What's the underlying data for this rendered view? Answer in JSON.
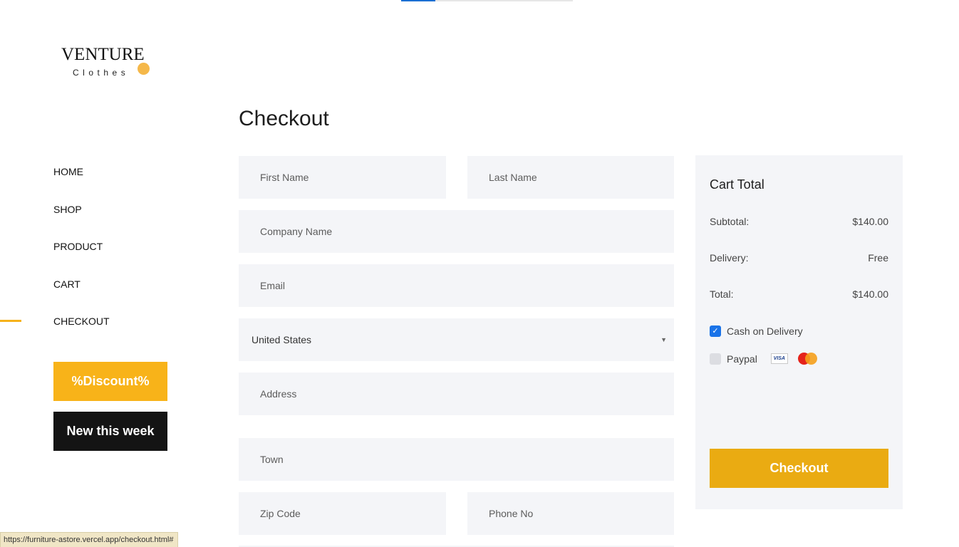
{
  "brand": {
    "name": "VENTURE",
    "tagline": "Clothes",
    "accent_color": "#f5b84a"
  },
  "scroll_progress": 0.2,
  "nav": {
    "items": [
      {
        "label": "HOME",
        "active": false
      },
      {
        "label": "SHOP",
        "active": false
      },
      {
        "label": "PRODUCT",
        "active": false
      },
      {
        "label": "CART",
        "active": false
      },
      {
        "label": "CHECKOUT",
        "active": true
      }
    ],
    "active_color": "#f6b21b"
  },
  "promos": {
    "discount_label": "%Discount%",
    "new_label": "New this week",
    "discount_color": "#f8b319",
    "new_color": "#141414"
  },
  "page_title": "Checkout",
  "form": {
    "first_name_placeholder": "First Name",
    "last_name_placeholder": "Last Name",
    "company_placeholder": "Company Name",
    "email_placeholder": "Email",
    "country_value": "United States",
    "address_placeholder": "Address",
    "town_placeholder": "Town",
    "zip_placeholder": "Zip Code",
    "phone_placeholder": "Phone No"
  },
  "cart": {
    "title": "Cart Total",
    "subtotal_label": "Subtotal:",
    "subtotal_value": "$140.00",
    "delivery_label": "Delivery:",
    "delivery_value": "Free",
    "total_label": "Total:",
    "total_value": "$140.00",
    "payment_options": [
      {
        "label": "Cash on Delivery",
        "checked": true
      },
      {
        "label": "Paypal",
        "checked": false
      }
    ],
    "card_icons": [
      "visa-card-icon",
      "mastercard-icon"
    ],
    "checkout_label": "Checkout",
    "checkout_color": "#eaab12"
  },
  "status_bar": {
    "url": "https://furniture-astore.vercel.app/checkout.html#"
  }
}
